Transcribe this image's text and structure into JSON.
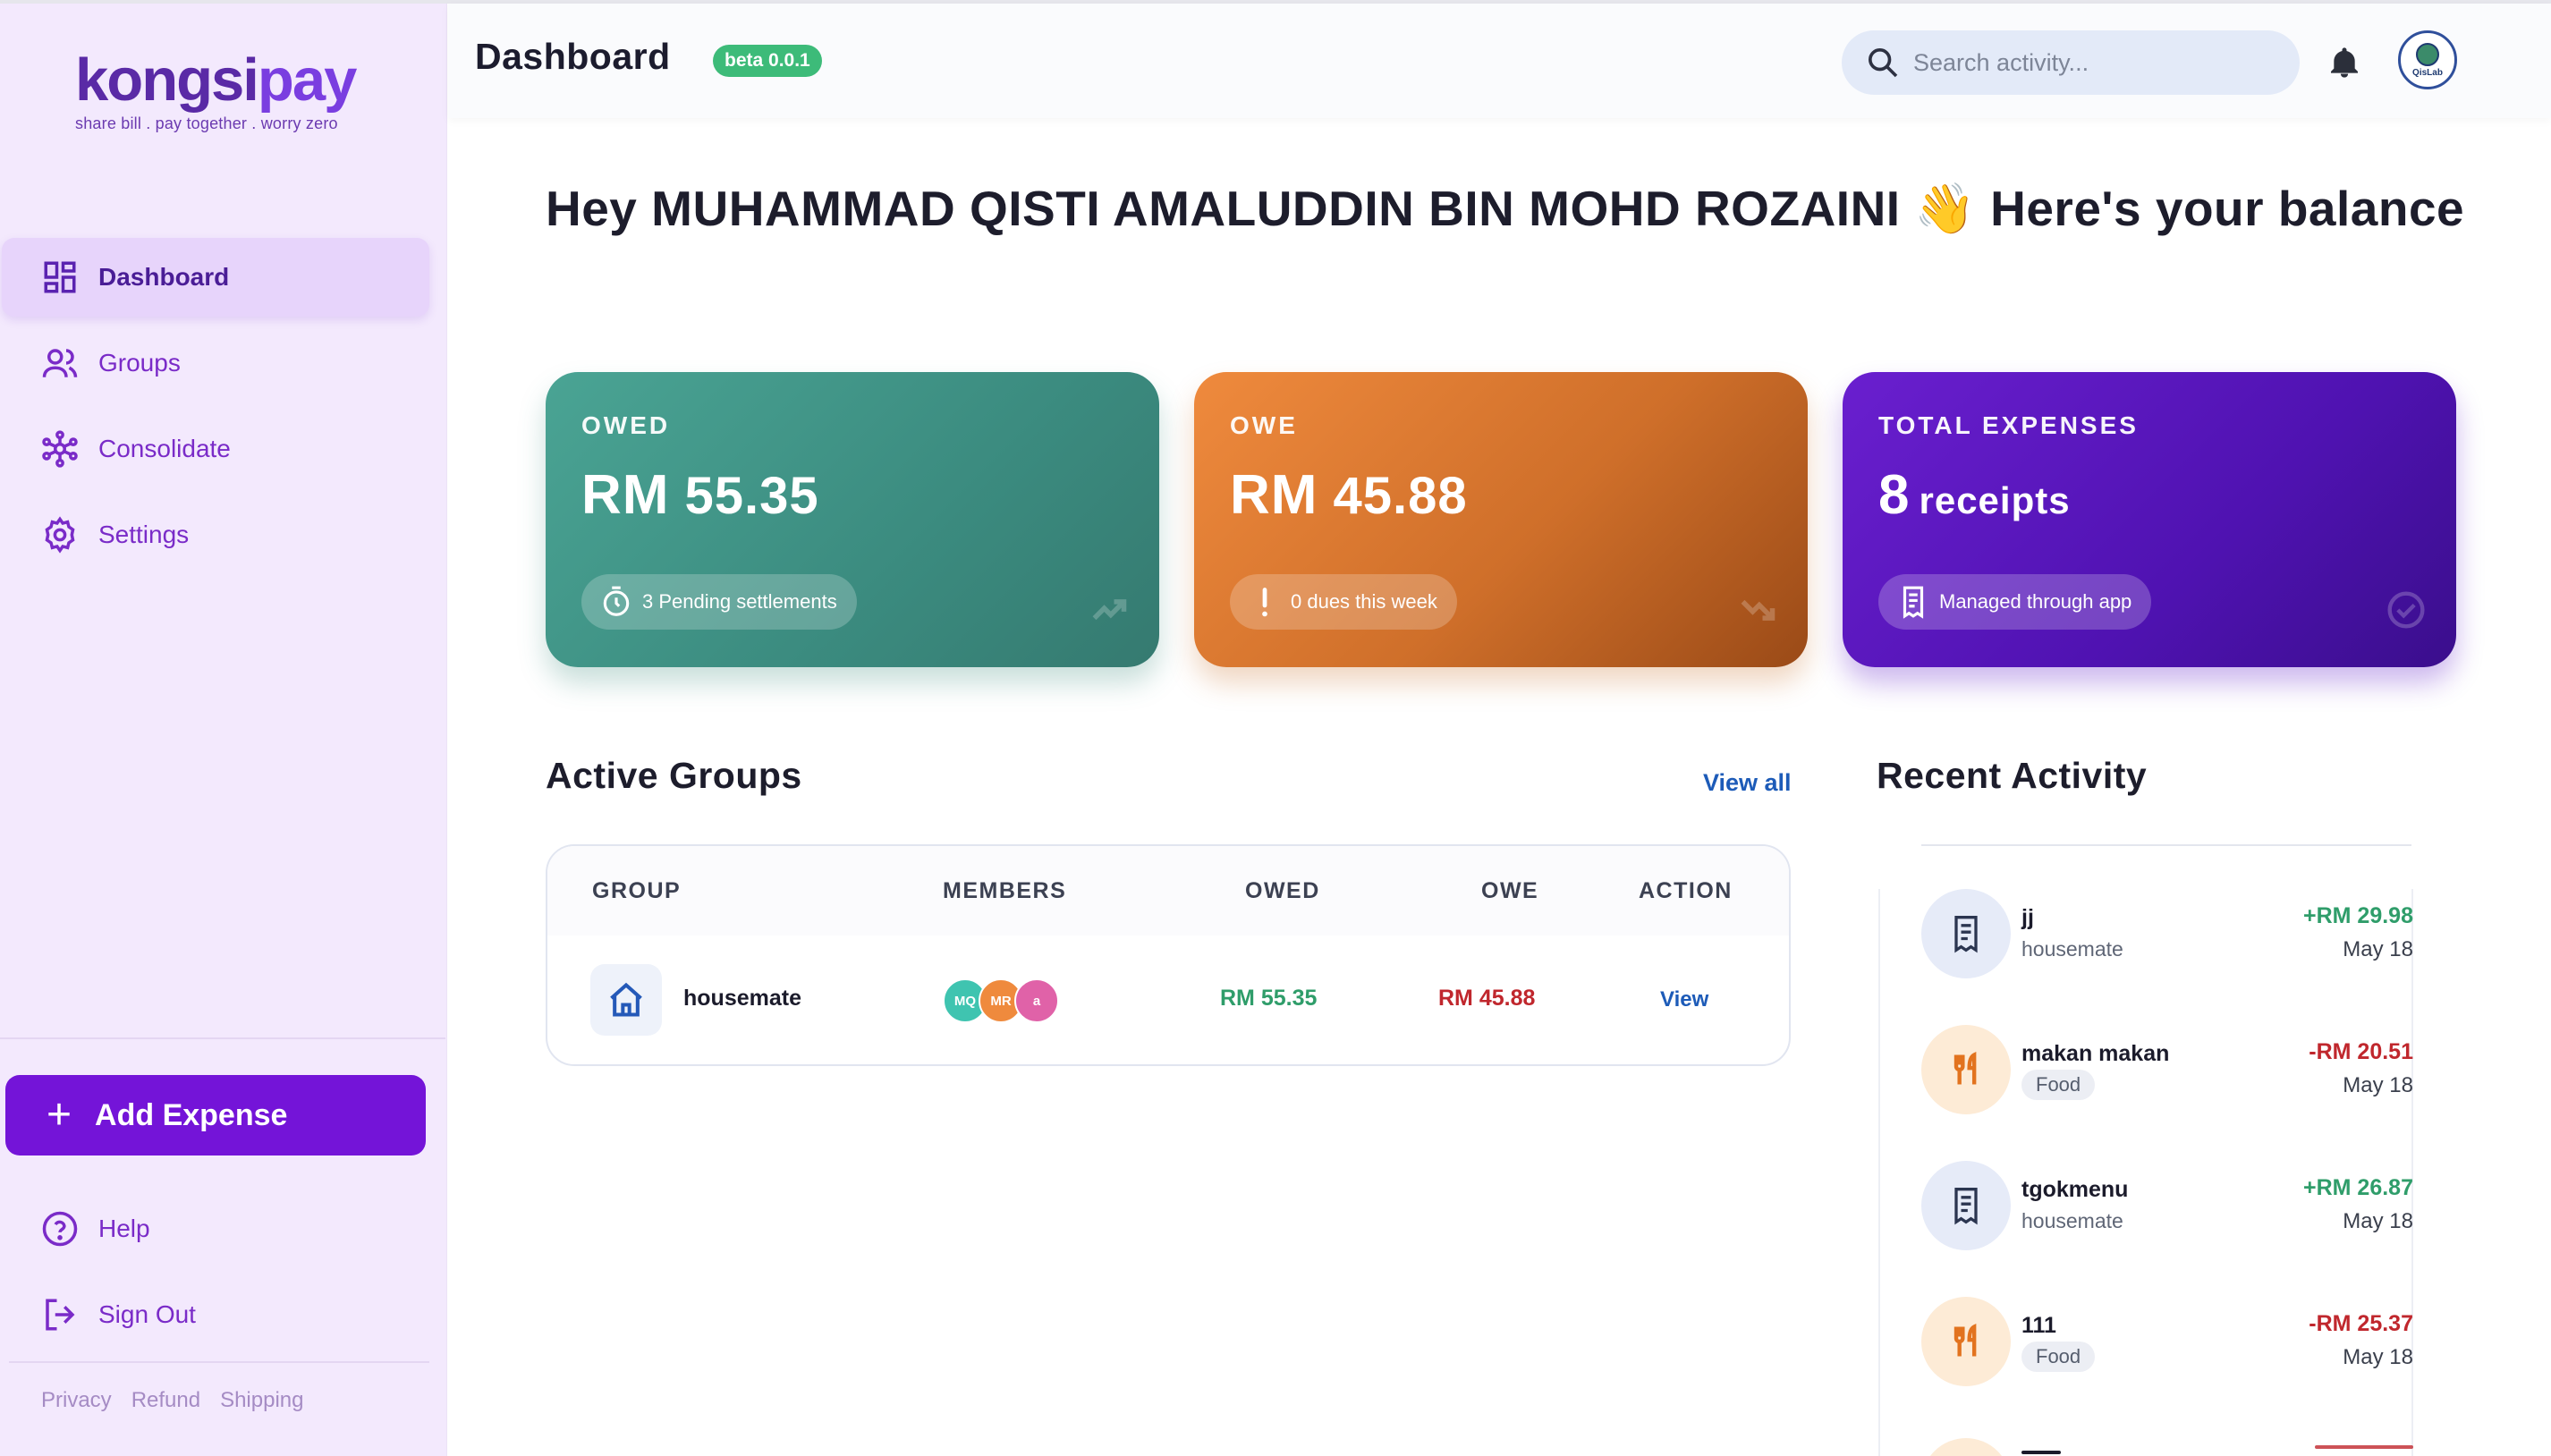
{
  "brand": {
    "name_part1": "kongsi",
    "name_part2": "pay",
    "tagline": "share bill . pay together . worry zero"
  },
  "sidebar": {
    "items": [
      {
        "label": "Dashboard",
        "icon": "dashboard-icon",
        "active": true
      },
      {
        "label": "Groups",
        "icon": "users-icon"
      },
      {
        "label": "Consolidate",
        "icon": "network-icon"
      },
      {
        "label": "Settings",
        "icon": "gear-icon"
      }
    ],
    "add_expense_label": "Add Expense",
    "help_label": "Help",
    "signout_label": "Sign Out",
    "footer_links": [
      "Privacy",
      "Refund",
      "Shipping"
    ]
  },
  "header": {
    "title": "Dashboard",
    "badge": "beta 0.0.1",
    "search_placeholder": "Search activity...",
    "avatar_label": "QisLab"
  },
  "greeting": "Hey MUHAMMAD QISTI AMALUDDIN BIN MOHD ROZAINI 👋 Here's your balance",
  "cards": {
    "owed": {
      "label": "OWED",
      "currency": "RM",
      "amount": "55.35",
      "pill": "3 Pending settlements"
    },
    "owe": {
      "label": "OWE",
      "currency": "RM",
      "amount": "45.88",
      "pill": "0 dues this week"
    },
    "total": {
      "label": "TOTAL EXPENSES",
      "count": "8",
      "unit": "receipts",
      "pill": "Managed through app"
    }
  },
  "active_groups": {
    "title": "Active Groups",
    "view_all": "View all",
    "columns": [
      "GROUP",
      "MEMBERS",
      "OWED",
      "OWE",
      "ACTION"
    ],
    "rows": [
      {
        "name": "housemate",
        "members": [
          {
            "initials": "MQ",
            "color": "#3fc4b0"
          },
          {
            "initials": "MR",
            "color": "#ef8a3d"
          },
          {
            "initials": "a",
            "color": "#e062a8"
          }
        ],
        "owed": "RM 55.35",
        "owe": "RM 45.88",
        "action": "View"
      }
    ]
  },
  "recent_activity": {
    "title": "Recent Activity",
    "items": [
      {
        "name": "jj",
        "sub": "housemate",
        "amount": "+RM 29.98",
        "date": "May 18",
        "kind": "receipt"
      },
      {
        "name": "makan makan",
        "tag": "Food",
        "amount": "-RM 20.51",
        "date": "May 18",
        "kind": "food"
      },
      {
        "name": "tgokmenu",
        "sub": "housemate",
        "amount": "+RM 26.87",
        "date": "May 18",
        "kind": "receipt"
      },
      {
        "name": "111",
        "tag": "Food",
        "amount": "-RM 25.37",
        "date": "May 18",
        "kind": "food"
      }
    ]
  },
  "colors": {
    "brand_purple": "#7414d8",
    "owed_green": "#2f9d6a",
    "owe_red": "#c0272d",
    "link_blue": "#1d5bb8"
  }
}
